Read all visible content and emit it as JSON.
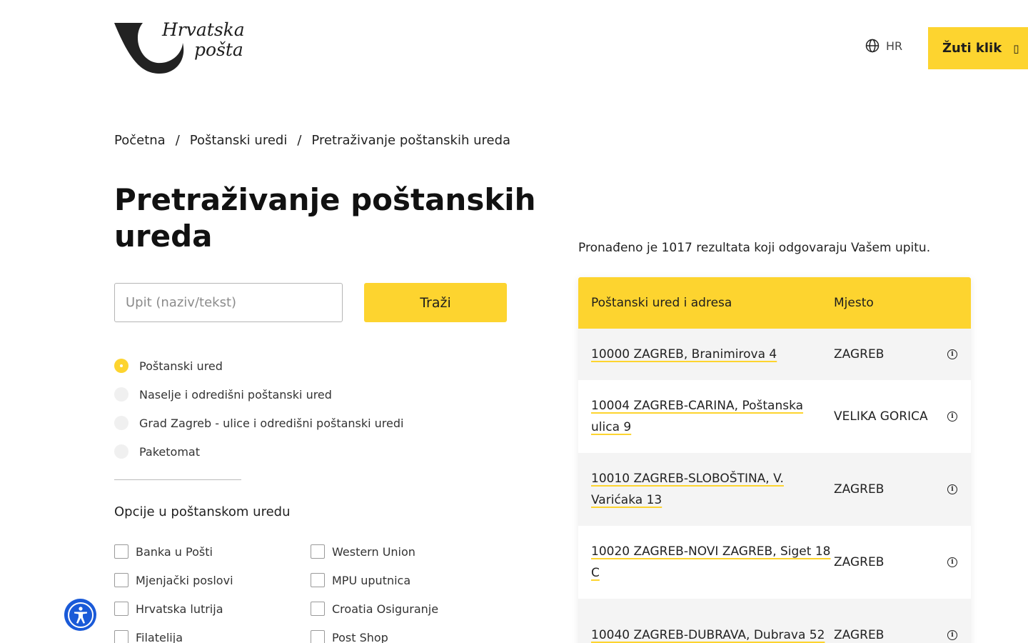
{
  "header": {
    "logo_line1": "Hrvatska",
    "logo_line2": "pošta",
    "language": "HR",
    "cta_label": "Žuti klik",
    "cta_icon": "box"
  },
  "breadcrumb": [
    "Početna",
    "Poštanski uredi",
    "Pretraživanje poštanskih ureda"
  ],
  "page_title": "Pretraživanje poštanskih ureda",
  "search": {
    "placeholder": "Upit (naziv/tekst)",
    "button_label": "Traži"
  },
  "search_types": [
    {
      "label": "Poštanski ured",
      "selected": true
    },
    {
      "label": "Naselje i odredišni poštanski ured",
      "selected": false
    },
    {
      "label": "Grad Zagreb - ulice i odredišni poštanski uredi",
      "selected": false
    },
    {
      "label": "Paketomat",
      "selected": false
    }
  ],
  "options_title": "Opcije u poštanskom uredu",
  "options": [
    {
      "label": "Banka u Pošti",
      "checked": false
    },
    {
      "label": "Western Union",
      "checked": false
    },
    {
      "label": "Mjenjački poslovi",
      "checked": false
    },
    {
      "label": "MPU uputnica",
      "checked": false
    },
    {
      "label": "Hrvatska lutrija",
      "checked": false
    },
    {
      "label": "Croatia Osiguranje",
      "checked": false
    },
    {
      "label": "Filatelija",
      "checked": false
    },
    {
      "label": "Post Shop",
      "checked": false
    }
  ],
  "results": {
    "summary": "Pronađeno je 1017 rezultata koji odgovaraju Vašem upitu.",
    "columns": [
      "Poštanski ured i adresa",
      "Mjesto"
    ],
    "rows": [
      {
        "address": "10000 ZAGREB, Branimirova 4",
        "place": "ZAGREB"
      },
      {
        "address": "10004 ZAGREB-CARINA, Poštanska ulica 9",
        "place": "VELIKA GORICA"
      },
      {
        "address": "10010 ZAGREB-SLOBOŠTINA, V. Varićaka 13",
        "place": "ZAGREB"
      },
      {
        "address": "10020 ZAGREB-NOVI ZAGREB, Siget 18 C",
        "place": "ZAGREB"
      },
      {
        "address": "10040 ZAGREB-DUBRAVA, Dubrava 52",
        "place": "ZAGREB"
      }
    ]
  },
  "colors": {
    "accent": "#fdd42f",
    "accessibility": "#1a5ad8"
  }
}
